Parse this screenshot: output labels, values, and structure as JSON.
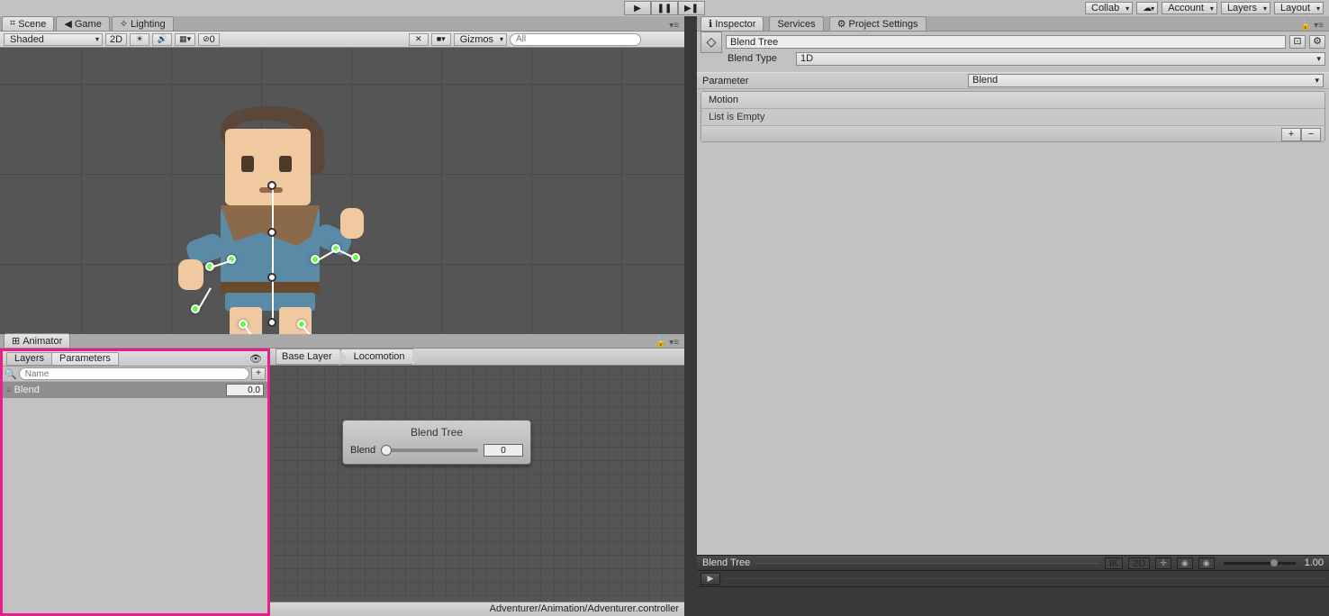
{
  "topbar": {
    "collab": "Collab",
    "account": "Account",
    "layers": "Layers",
    "layout": "Layout"
  },
  "tabs": {
    "scene": "Scene",
    "game": "Game",
    "lighting": "Lighting"
  },
  "sceneToolbar": {
    "shaded": "Shaded",
    "twoD": "2D",
    "gizmos": "Gizmos",
    "searchAll": "All",
    "effectsCount": "0"
  },
  "animator": {
    "tab": "Animator",
    "layersTab": "Layers",
    "parametersTab": "Parameters",
    "namePlaceholder": "Name",
    "param_name": "Blend",
    "param_value": "0.0",
    "breadcrumb1": "Base Layer",
    "breadcrumb2": "Locomotion",
    "node_title": "Blend Tree",
    "node_param": "Blend",
    "node_value": "0",
    "statusPath": "Adventurer/Animation/Adventurer.controller"
  },
  "inspector": {
    "tab_inspector": "Inspector",
    "tab_services": "Services",
    "tab_projsettings": "Project Settings",
    "name": "Blend Tree",
    "blendTypeLabel": "Blend Type",
    "blendTypeValue": "1D",
    "parameterLabel": "Parameter",
    "parameterValue": "Blend",
    "motionHeader": "Motion",
    "listEmpty": "List is Empty"
  },
  "preview": {
    "title": "Blend Tree",
    "ik": "IK",
    "twoD": "2D",
    "speed": "1.00"
  }
}
